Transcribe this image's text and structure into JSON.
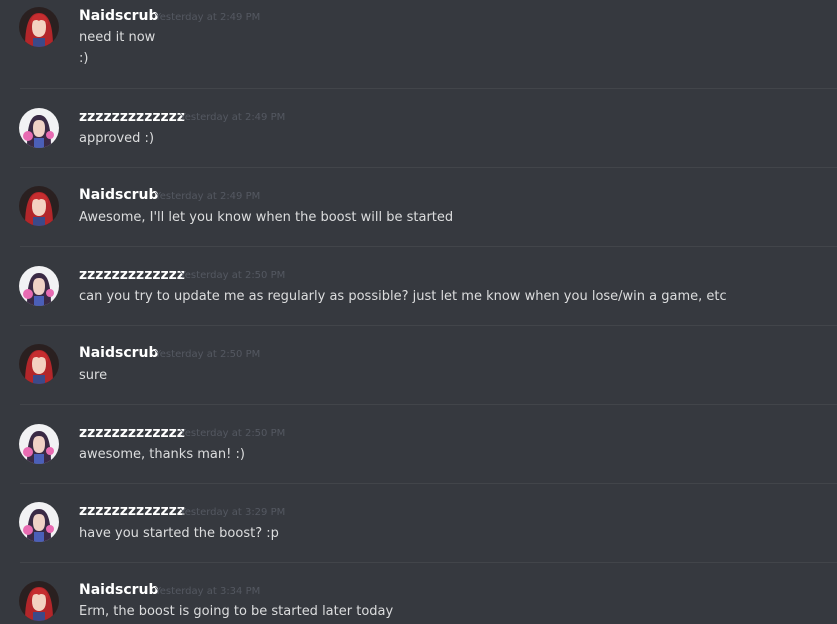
{
  "messages": [
    {
      "author": "Naidscrub",
      "avatar": "red-haired-anime-avatar",
      "timestamp": "Yesterday at 2:49 PM",
      "lines": [
        "need it now",
        ":)"
      ]
    },
    {
      "author": "zzzzzzzzzzzzz",
      "avatar": "dva-anime-avatar",
      "timestamp": "Yesterday at 2:49 PM",
      "lines": [
        "approved :)"
      ]
    },
    {
      "author": "Naidscrub",
      "avatar": "red-haired-anime-avatar",
      "timestamp": "Yesterday at 2:49 PM",
      "lines": [
        "Awesome, I'll let you know when the boost will be started"
      ]
    },
    {
      "author": "zzzzzzzzzzzzz",
      "avatar": "dva-anime-avatar",
      "timestamp": "Yesterday at 2:50 PM",
      "lines": [
        "can you try to update me as regularly as possible? just let me know when you lose/win a game, etc"
      ]
    },
    {
      "author": "Naidscrub",
      "avatar": "red-haired-anime-avatar",
      "timestamp": "Yesterday at 2:50 PM",
      "lines": [
        "sure"
      ]
    },
    {
      "author": "zzzzzzzzzzzzz",
      "avatar": "dva-anime-avatar",
      "timestamp": "Yesterday at 2:50 PM",
      "lines": [
        "awesome, thanks man! :)"
      ]
    },
    {
      "author": "zzzzzzzzzzzzz",
      "avatar": "dva-anime-avatar",
      "timestamp": "Yesterday at 3:29 PM",
      "lines": [
        "have you started the boost? :p"
      ]
    },
    {
      "author": "Naidscrub",
      "avatar": "red-haired-anime-avatar",
      "timestamp": "Yesterday at 3:34 PM",
      "lines": [
        "Erm, the boost is going to be started later today"
      ]
    }
  ],
  "colors": {
    "background": "#36393f",
    "divider": "#42454a",
    "username": "#ffffff",
    "timestamp": "#545861",
    "text": "#dcddde"
  }
}
